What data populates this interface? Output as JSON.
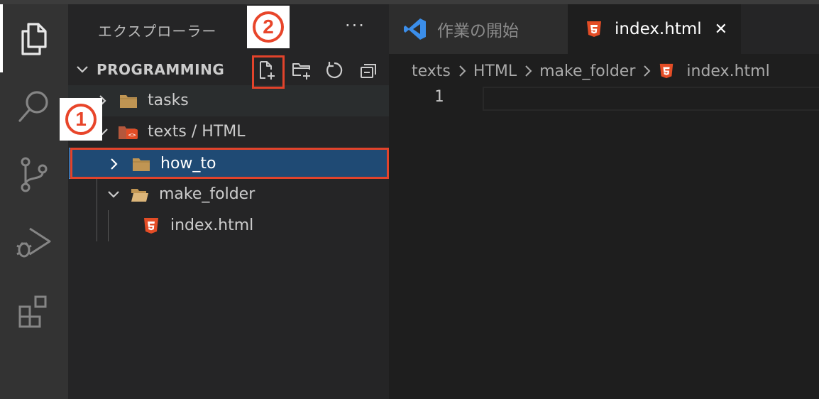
{
  "sidebar": {
    "title": "エクスプローラー",
    "more": "···",
    "section": "PROGRAMMING",
    "tree": {
      "tasks": "tasks",
      "texts_html": "texts / HTML",
      "how_to": "how_to",
      "make_folder": "make_folder",
      "index_html": "index.html"
    }
  },
  "tabs": {
    "welcome": "作業の開始",
    "index": "index.html",
    "close_glyph": "✕"
  },
  "breadcrumb": {
    "c1": "texts",
    "c2": "HTML",
    "c3": "make_folder",
    "c4": "index.html"
  },
  "editor": {
    "line_number": "1"
  },
  "annotations": {
    "one": "1",
    "two": "2"
  },
  "colors": {
    "accent": "#e2432b",
    "selection": "#1f4a74",
    "html5": "#e44d26",
    "folder": "#c09553",
    "vscode_blue": "#3b8eea"
  }
}
